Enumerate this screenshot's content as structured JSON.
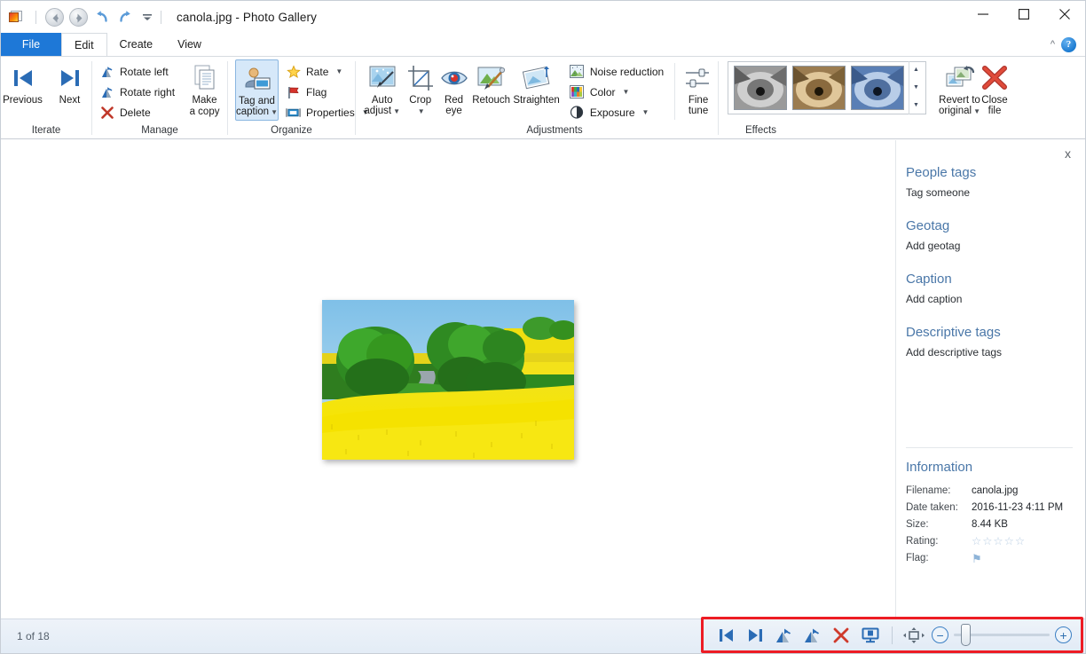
{
  "window": {
    "title": "canola.jpg - Photo Gallery",
    "app_icon": "photo-gallery-icon",
    "quick_access": [
      {
        "name": "back",
        "icon": "back-arrow-icon"
      },
      {
        "name": "forward",
        "icon": "forward-arrow-icon"
      },
      {
        "name": "undo",
        "icon": "undo-arrow-icon"
      },
      {
        "name": "redo",
        "icon": "redo-arrow-icon"
      },
      {
        "name": "customize",
        "icon": "chevron-down-icon"
      }
    ],
    "controls": {
      "minimize": "minimize-icon",
      "maximize": "maximize-icon",
      "close": "close-icon"
    }
  },
  "tabs": [
    {
      "label": "File",
      "state": "file"
    },
    {
      "label": "Edit",
      "state": "active"
    },
    {
      "label": "Create",
      "state": "normal"
    },
    {
      "label": "View",
      "state": "normal"
    }
  ],
  "ribbon_help": {
    "collapse": "chevron-up-icon",
    "help": "?"
  },
  "ribbon": {
    "groups": [
      {
        "label": "Iterate",
        "buttons": [
          {
            "label": "Previous",
            "icon": "previous-icon",
            "size": "large"
          },
          {
            "label": "Next",
            "icon": "next-icon",
            "size": "large"
          }
        ]
      },
      {
        "label": "Manage",
        "buttons": [
          {
            "label": "Rotate left",
            "icon": "rotate-left-icon",
            "size": "small"
          },
          {
            "label": "Rotate right",
            "icon": "rotate-right-icon",
            "size": "small"
          },
          {
            "label": "Delete",
            "icon": "delete-x-icon",
            "size": "small"
          },
          {
            "label": "Make\na copy",
            "label_l1": "Make",
            "label_l2": "a copy",
            "icon": "copy-icon",
            "size": "large"
          }
        ]
      },
      {
        "label": "Organize",
        "buttons": [
          {
            "label_l1": "Tag and",
            "label_l2": "caption",
            "icon": "tag-caption-icon",
            "size": "large",
            "selected": true,
            "dropdown": true
          },
          {
            "label": "Rate",
            "icon": "star-icon",
            "size": "small",
            "dropdown": true
          },
          {
            "label": "Flag",
            "icon": "flag-icon",
            "size": "small"
          },
          {
            "label": "Properties",
            "icon": "properties-icon",
            "size": "small",
            "dropdown": true
          }
        ]
      },
      {
        "label": "Adjustments",
        "buttons": [
          {
            "label_l1": "Auto",
            "label_l2": "adjust",
            "icon": "auto-adjust-icon",
            "size": "large",
            "dropdown": true
          },
          {
            "label_l1": "Crop",
            "label_l2": "",
            "icon": "crop-icon",
            "size": "large",
            "dropdown": true
          },
          {
            "label_l1": "Red",
            "label_l2": "eye",
            "icon": "red-eye-icon",
            "size": "large"
          },
          {
            "label": "Retouch",
            "icon": "retouch-icon",
            "size": "large"
          },
          {
            "label": "Straighten",
            "icon": "straighten-icon",
            "size": "large"
          },
          {
            "label": "Noise reduction",
            "icon": "noise-reduction-icon",
            "size": "small"
          },
          {
            "label": "Color",
            "icon": "color-icon",
            "size": "small",
            "dropdown": true
          },
          {
            "label": "Exposure",
            "icon": "exposure-icon",
            "size": "small",
            "dropdown": true
          },
          {
            "label_l1": "Fine",
            "label_l2": "tune",
            "icon": "fine-tune-icon",
            "size": "large"
          }
        ]
      },
      {
        "label": "Effects",
        "thumbnails": [
          "effect-black-and-white",
          "effect-sepia",
          "effect-cyanotype"
        ],
        "scroll": [
          "scroll-up-icon",
          "scroll-down-icon",
          "more-effects-icon"
        ],
        "buttons": [
          {
            "label_l1": "Revert to",
            "label_l2": "original",
            "icon": "revert-icon",
            "size": "large",
            "dropdown": true
          },
          {
            "label_l1": "Close",
            "label_l2": "file",
            "icon": "close-file-icon",
            "size": "large"
          }
        ]
      }
    ]
  },
  "photo": {
    "alt": "canola field photo with trees and a path",
    "filename": "canola.jpg"
  },
  "sidebar": {
    "close_label": "x",
    "sections": [
      {
        "heading": "People tags",
        "action": "Tag someone"
      },
      {
        "heading": "Geotag",
        "action": "Add geotag"
      },
      {
        "heading": "Caption",
        "action": "Add caption"
      },
      {
        "heading": "Descriptive tags",
        "action": "Add descriptive tags"
      }
    ],
    "information": {
      "heading": "Information",
      "rows": [
        {
          "key": "Filename:",
          "value": "canola.jpg",
          "type": "text"
        },
        {
          "key": "Date taken:",
          "value": "2016-11-23  4:11 PM",
          "type": "text"
        },
        {
          "key": "Size:",
          "value": "8.44 KB",
          "type": "text"
        },
        {
          "key": "Rating:",
          "value": "☆☆☆☆☆",
          "type": "stars"
        },
        {
          "key": "Flag:",
          "value": "⚑",
          "type": "flag"
        }
      ]
    }
  },
  "statusbar": {
    "counter": "1 of 18",
    "toolbar_highlight_color": "#ed1c24",
    "buttons": [
      {
        "name": "previous-image",
        "icon": "skip-back-icon"
      },
      {
        "name": "next-image",
        "icon": "skip-forward-icon"
      },
      {
        "name": "rotate-counterclockwise",
        "icon": "rotate-left-icon"
      },
      {
        "name": "rotate-clockwise",
        "icon": "rotate-right-icon"
      },
      {
        "name": "delete-image",
        "icon": "delete-x-icon"
      },
      {
        "name": "play-slideshow",
        "icon": "slideshow-icon"
      },
      {
        "name": "fit-to-window",
        "icon": "fit-to-window-icon"
      }
    ],
    "zoom": {
      "out_label": "−",
      "in_label": "+",
      "value": 8
    }
  },
  "colors": {
    "accent_blue": "#1e78d7",
    "heading_blue": "#4a77a8",
    "highlight_red": "#ed1c24",
    "icon_blue": "#2b6cb5"
  }
}
